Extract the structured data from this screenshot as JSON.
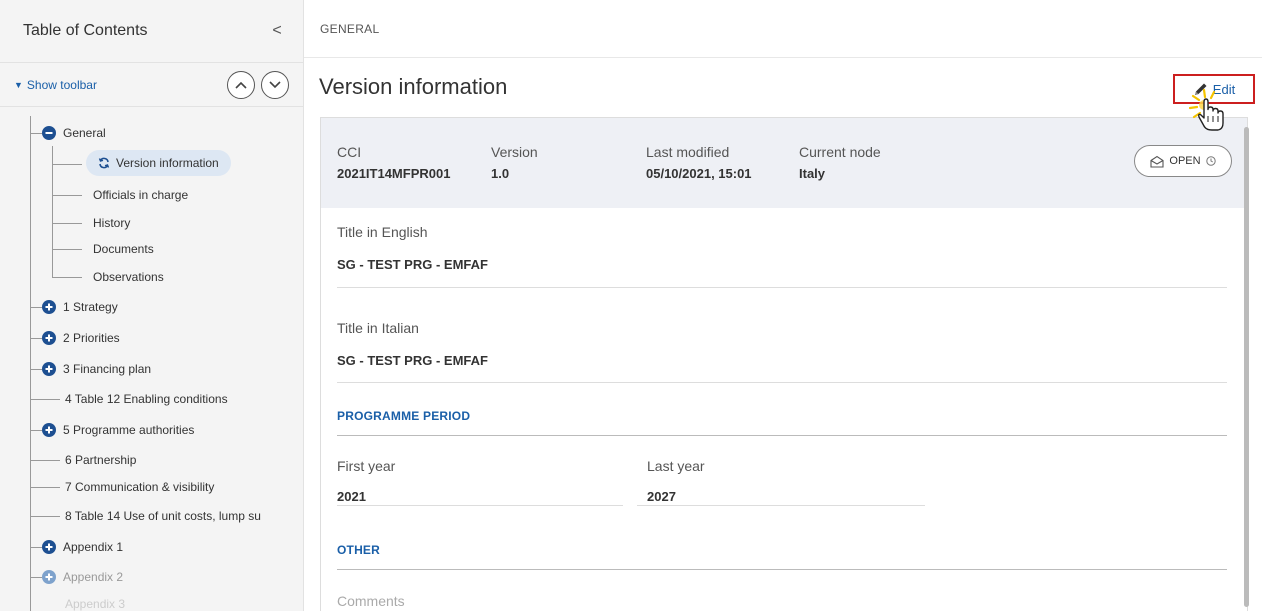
{
  "sidebar": {
    "title": "Table of Contents",
    "collapse_glyph": "<",
    "show_toolbar_label": "Show toolbar",
    "tree": {
      "general": "General",
      "version_information": "Version information",
      "officials": "Officials in charge",
      "history": "History",
      "documents": "Documents",
      "observations": "Observations",
      "strategy": "1 Strategy",
      "priorities": "2 Priorities",
      "financing": "3 Financing plan",
      "enabling": "4 Table 12 Enabling conditions",
      "authorities": "5 Programme authorities",
      "partnership": "6 Partnership",
      "communication": "7 Communication & visibility",
      "unit_costs": "8 Table 14 Use of unit costs, lump su",
      "appendix1": "Appendix 1",
      "appendix2": "Appendix 2",
      "appendix3": "Appendix 3"
    }
  },
  "main": {
    "breadcrumb": "GENERAL",
    "title": "Version information",
    "edit_label": "Edit",
    "meta": {
      "cci_label": "CCI",
      "cci_value": "2021IT14MFPR001",
      "version_label": "Version",
      "version_value": "1.0",
      "modified_label": "Last modified",
      "modified_value": "05/10/2021, 15:01",
      "node_label": "Current node",
      "node_value": "Italy",
      "status": "OPEN"
    },
    "fields": {
      "title_en_label": "Title in English",
      "title_en_value": "SG - TEST PRG - EMFAF",
      "title_it_label": "Title in Italian",
      "title_it_value": "SG - TEST PRG - EMFAF",
      "period_section": "PROGRAMME PERIOD",
      "first_year_label": "First year",
      "first_year_value": "2021",
      "last_year_label": "Last year",
      "last_year_value": "2027",
      "other_section": "OTHER",
      "comments_label": "Comments"
    }
  },
  "colors": {
    "accent": "#1a5fa8",
    "node_icon": "#1d4f91",
    "highlight_border": "#cc1f1f",
    "meta_bg": "#eef0f5",
    "selected_bg": "#dde7f3"
  }
}
